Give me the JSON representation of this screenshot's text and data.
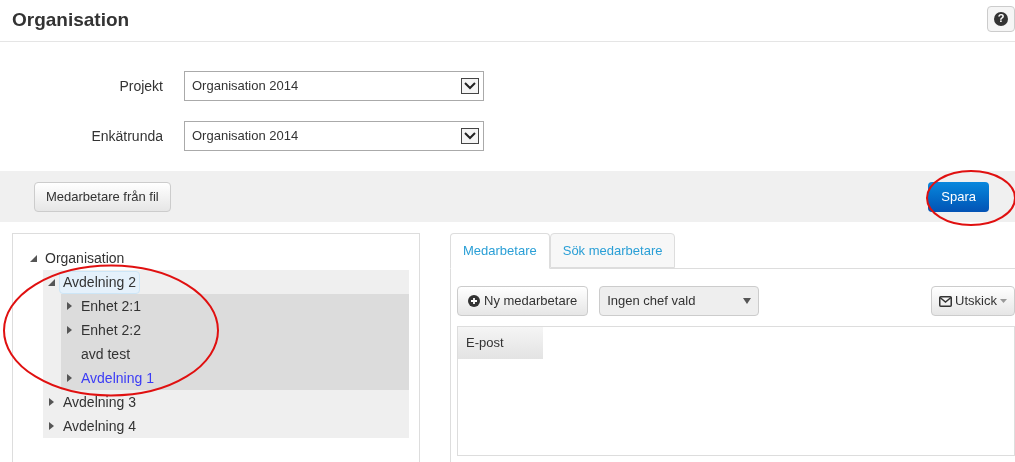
{
  "page": {
    "title": "Organisation",
    "help_icon": "?"
  },
  "form": [
    {
      "label": "Projekt",
      "value": "Organisation 2014"
    },
    {
      "label": "Enkätrunda",
      "value": "Organisation 2014"
    }
  ],
  "toolbar": {
    "import_button": "Medarbetare från fil",
    "save_button": "Spara"
  },
  "tree": [
    {
      "label": "Organisation",
      "expanded": true,
      "selected": false,
      "active": false,
      "children": [
        {
          "label": "Avdelning 2",
          "expanded": true,
          "selected": true,
          "active": false,
          "children": [
            {
              "label": "Enhet 2:1",
              "expanded": false,
              "selected": false,
              "active": false,
              "has_children": true
            },
            {
              "label": "Enhet 2:2",
              "expanded": false,
              "selected": false,
              "active": false,
              "has_children": true
            },
            {
              "label": "avd test",
              "selected": false,
              "active": false,
              "has_children": false
            },
            {
              "label": "Avdelning 1",
              "expanded": false,
              "selected": false,
              "active": true,
              "has_children": true
            }
          ]
        },
        {
          "label": "Avdelning 3",
          "expanded": false,
          "selected": false,
          "active": false,
          "has_children": true
        },
        {
          "label": "Avdelning 4",
          "expanded": false,
          "selected": false,
          "active": false,
          "has_children": true
        }
      ]
    }
  ],
  "tabs": [
    {
      "label": "Medarbetare",
      "selected": true
    },
    {
      "label": "Sök medarbetare",
      "selected": false
    }
  ],
  "actions": {
    "new_button": "Ny medarbetare",
    "manager_select": "Ingen chef vald",
    "send_button": "Utskick"
  },
  "table": {
    "columns": [
      "E-post"
    ]
  }
}
